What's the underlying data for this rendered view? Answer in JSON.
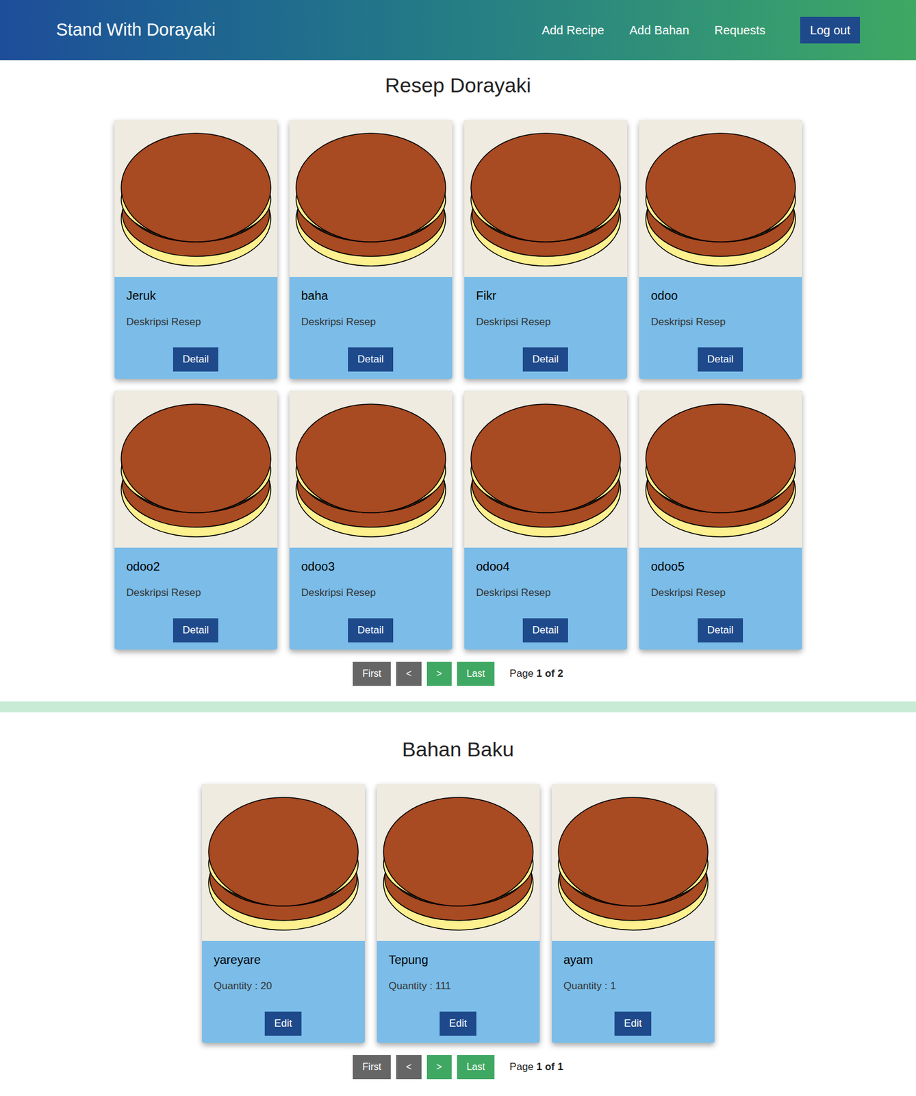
{
  "header": {
    "title": "Stand With Dorayaki",
    "nav": [
      "Add Recipe",
      "Add Bahan",
      "Requests"
    ],
    "logout": "Log out"
  },
  "recipes": {
    "title": "Resep Dorayaki",
    "button": "Detail",
    "cards": [
      {
        "name": "Jeruk",
        "text": "Deskripsi Resep"
      },
      {
        "name": "baha",
        "text": "Deskripsi Resep"
      },
      {
        "name": "Fikr",
        "text": "Deskripsi Resep"
      },
      {
        "name": "odoo",
        "text": "Deskripsi Resep"
      },
      {
        "name": "odoo2",
        "text": "Deskripsi Resep"
      },
      {
        "name": "odoo3",
        "text": "Deskripsi Resep"
      },
      {
        "name": "odoo4",
        "text": "Deskripsi Resep"
      },
      {
        "name": "odoo5",
        "text": "Deskripsi Resep"
      }
    ],
    "pagination": {
      "buttons": [
        {
          "label": "First",
          "enabled": false
        },
        {
          "label": "<",
          "enabled": false
        },
        {
          "label": ">",
          "enabled": true
        },
        {
          "label": "Last",
          "enabled": true
        }
      ],
      "page_label": "Page",
      "page_value": "1 of 2"
    }
  },
  "ingredients": {
    "title": "Bahan Baku",
    "button": "Edit",
    "cards": [
      {
        "name": "yareyare",
        "text": "Quantity : 20"
      },
      {
        "name": "Tepung",
        "text": "Quantity : 111"
      },
      {
        "name": "ayam",
        "text": "Quantity : 1"
      }
    ],
    "pagination": {
      "buttons": [
        {
          "label": "First",
          "enabled": false
        },
        {
          "label": "<",
          "enabled": false
        },
        {
          "label": ">",
          "enabled": true
        },
        {
          "label": "Last",
          "enabled": true
        }
      ],
      "page_label": "Page",
      "page_value": "1 of 1"
    }
  }
}
